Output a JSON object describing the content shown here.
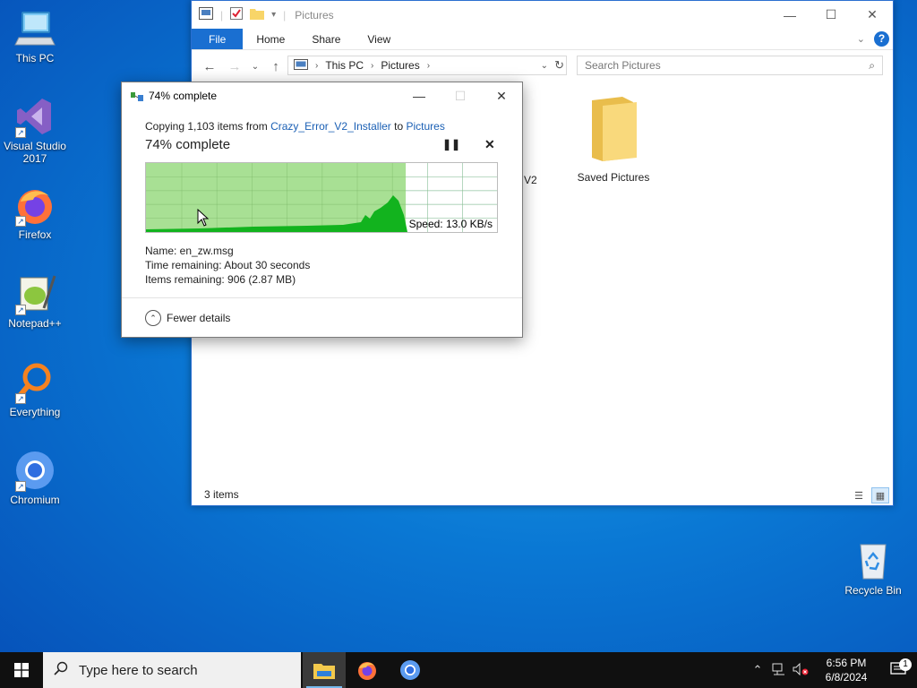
{
  "desktop": {
    "icons": [
      {
        "label": "This PC"
      },
      {
        "label": "Visual Studio 2017"
      },
      {
        "label": "Firefox"
      },
      {
        "label": "Notepad++"
      },
      {
        "label": "Everything"
      },
      {
        "label": "Chromium"
      },
      {
        "label": "Recycle Bin"
      }
    ]
  },
  "explorer": {
    "title": "Pictures",
    "ribbon_tabs": [
      "File",
      "Home",
      "Share",
      "View"
    ],
    "address": {
      "root": "This PC",
      "folder": "Pictures"
    },
    "search_placeholder": "Search Pictures",
    "items": [
      {
        "label": "V2"
      },
      {
        "label": "Saved Pictures"
      }
    ],
    "status": "3 items"
  },
  "dialog": {
    "title": "74% complete",
    "copy_prefix": "Copying 1,103 items from ",
    "source": "Crazy_Error_V2_Installer",
    "to_word": " to ",
    "destination": "Pictures",
    "percent_text": "74% complete",
    "progress": 0.74,
    "speed": "Speed: 13.0 KB/s",
    "name_line": "Name:  en_zw.msg",
    "time_line": "Time remaining:  About 30 seconds",
    "items_line": "Items remaining:  906 (2.87 MB)",
    "fewer_details": "Fewer details"
  },
  "taskbar": {
    "search_placeholder": "Type here to search",
    "time": "6:56 PM",
    "date": "6/8/2024",
    "notification_count": "1"
  },
  "colors": {
    "accent": "#1a6fd1",
    "progress_fill": "#a8e094",
    "graph_fill": "#12b31e",
    "taskbar": "#101010"
  }
}
